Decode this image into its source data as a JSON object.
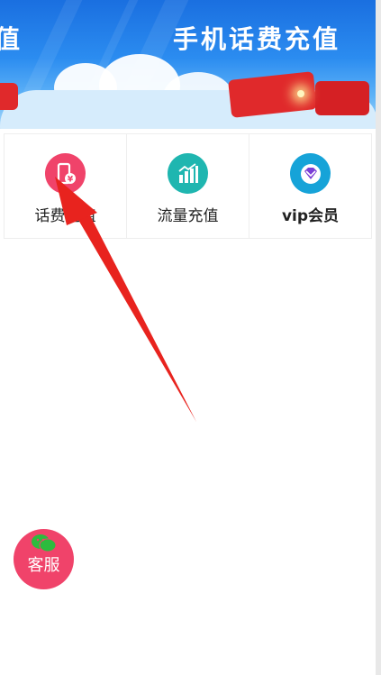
{
  "banner": {
    "text_left": "值",
    "text_right": "手机话费充值"
  },
  "services": [
    {
      "label": "话费充值",
      "icon": "phone-yen-icon",
      "color": "#f0436a"
    },
    {
      "label": "流量充值",
      "icon": "bar-chart-icon",
      "color": "#1fb6b0"
    },
    {
      "label": "vip会员",
      "icon": "diamond-icon",
      "color": "#16a3d8"
    }
  ],
  "float_button": {
    "label": "客服",
    "icon": "wechat-icon",
    "color": "#f0436a"
  },
  "annotation": {
    "type": "arrow",
    "color": "#e8231e"
  }
}
